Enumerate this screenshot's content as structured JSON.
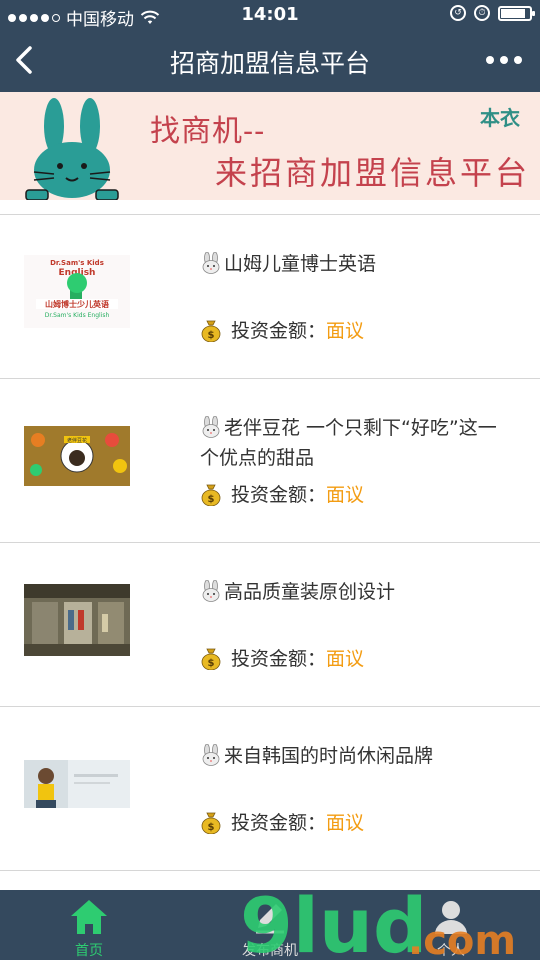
{
  "status": {
    "carrier": "中国移动",
    "time": "14:01",
    "battery_level": 0.85
  },
  "nav": {
    "title": "招商加盟信息平台"
  },
  "banner": {
    "line1": "找商机--",
    "line2": "来招商加盟信息平台",
    "brand": "本衣"
  },
  "items": [
    {
      "name": "山姆儿童博士英语",
      "invest_label": "投资金额：",
      "invest_value": "面议",
      "thumb_text_top": "Dr.Sam's Kids English",
      "thumb_text_cn": "山姆博士少儿英语",
      "thumb_text_bottom": "Dr.Sam's Kids English"
    },
    {
      "name": "老伴豆花 一个只剩下“好吃”这一个优点的甜品",
      "invest_label": "投资金额：",
      "invest_value": "面议",
      "thumb_text_top": "老伴豆花"
    },
    {
      "name": "高品质童装原创设计",
      "invest_label": "投资金额：",
      "invest_value": "面议"
    },
    {
      "name": "来自韩国的时尚休闲品牌",
      "invest_label": "投资金额：",
      "invest_value": "面议"
    }
  ],
  "tabs": [
    {
      "label": "首页",
      "icon": "home-icon",
      "active": true
    },
    {
      "label": "发布商机",
      "icon": "edit-icon",
      "active": false
    },
    {
      "label": "个人",
      "icon": "user-icon",
      "active": false
    }
  ],
  "watermark": {
    "text_main": "9lud",
    "text_dom": ".com"
  },
  "colors": {
    "header": "#34495e",
    "accent": "#2ecc71",
    "price": "#f39c12",
    "banner_text": "#c4424d"
  }
}
